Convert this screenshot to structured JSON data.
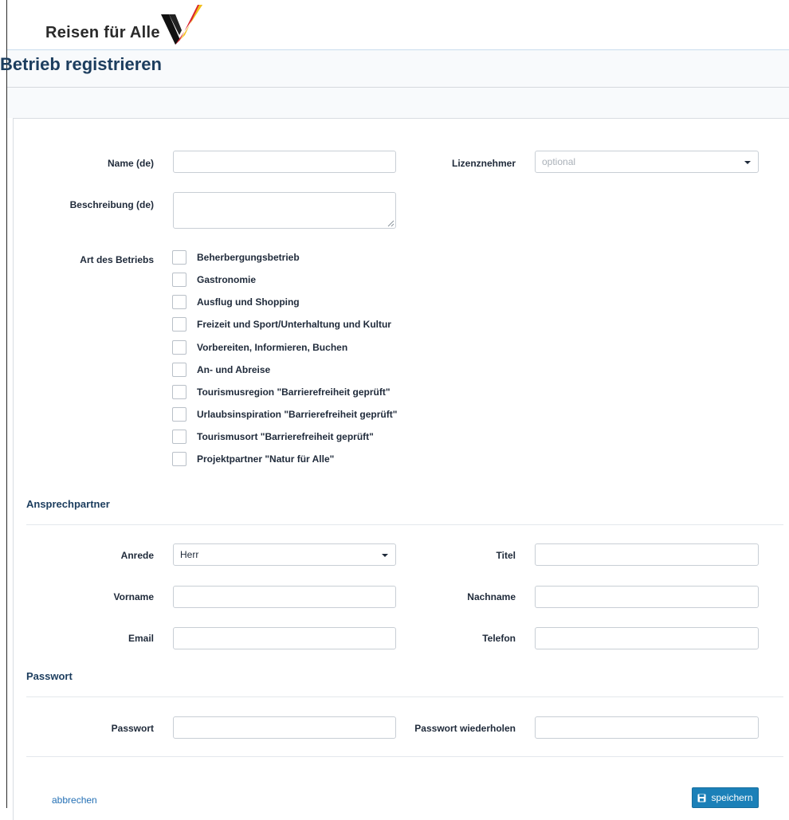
{
  "brand": {
    "name": "Reisen für Alle"
  },
  "page": {
    "title": "Betrieb registrieren"
  },
  "form": {
    "name_label": "Name (de)",
    "name_value": "",
    "licensee_label": "Lizenznehmer",
    "licensee_placeholder": "optional",
    "description_label": "Beschreibung (de)",
    "business_type_label": "Art des Betriebs",
    "business_types": [
      {
        "label": "Beherbergungsbetrieb",
        "checked": false
      },
      {
        "label": "Gastronomie",
        "checked": false
      },
      {
        "label": "Ausflug und Shopping",
        "checked": false
      },
      {
        "label": "Freizeit und Sport/Unterhaltung und Kultur",
        "checked": false
      },
      {
        "label": "Vorbereiten, Informieren, Buchen",
        "checked": false
      },
      {
        "label": "An- und Abreise",
        "checked": false
      },
      {
        "label": "Tourismusregion \"Barrierefreiheit geprüft\"",
        "checked": false
      },
      {
        "label": "Urlaubsinspiration \"Barrierefreiheit geprüft\"",
        "checked": false
      },
      {
        "label": "Tourismusort \"Barrierefreiheit geprüft\"",
        "checked": false
      },
      {
        "label": "Projektpartner \"Natur für Alle\"",
        "checked": false
      }
    ]
  },
  "contact": {
    "section_title": "Ansprechpartner",
    "salutation_label": "Anrede",
    "salutation_value": "Herr",
    "title_label": "Titel",
    "firstname_label": "Vorname",
    "lastname_label": "Nachname",
    "email_label": "Email",
    "phone_label": "Telefon"
  },
  "password": {
    "section_title": "Passwort",
    "password_label": "Passwort",
    "repeat_label": "Passwort wiederholen"
  },
  "actions": {
    "cancel_label": "abbrechen",
    "save_label": "speichern",
    "save_icon": "floppy-disk-icon"
  },
  "colors": {
    "title": "#1c3d5e",
    "link": "#2470b5",
    "primary_button": "#1b80b8"
  }
}
